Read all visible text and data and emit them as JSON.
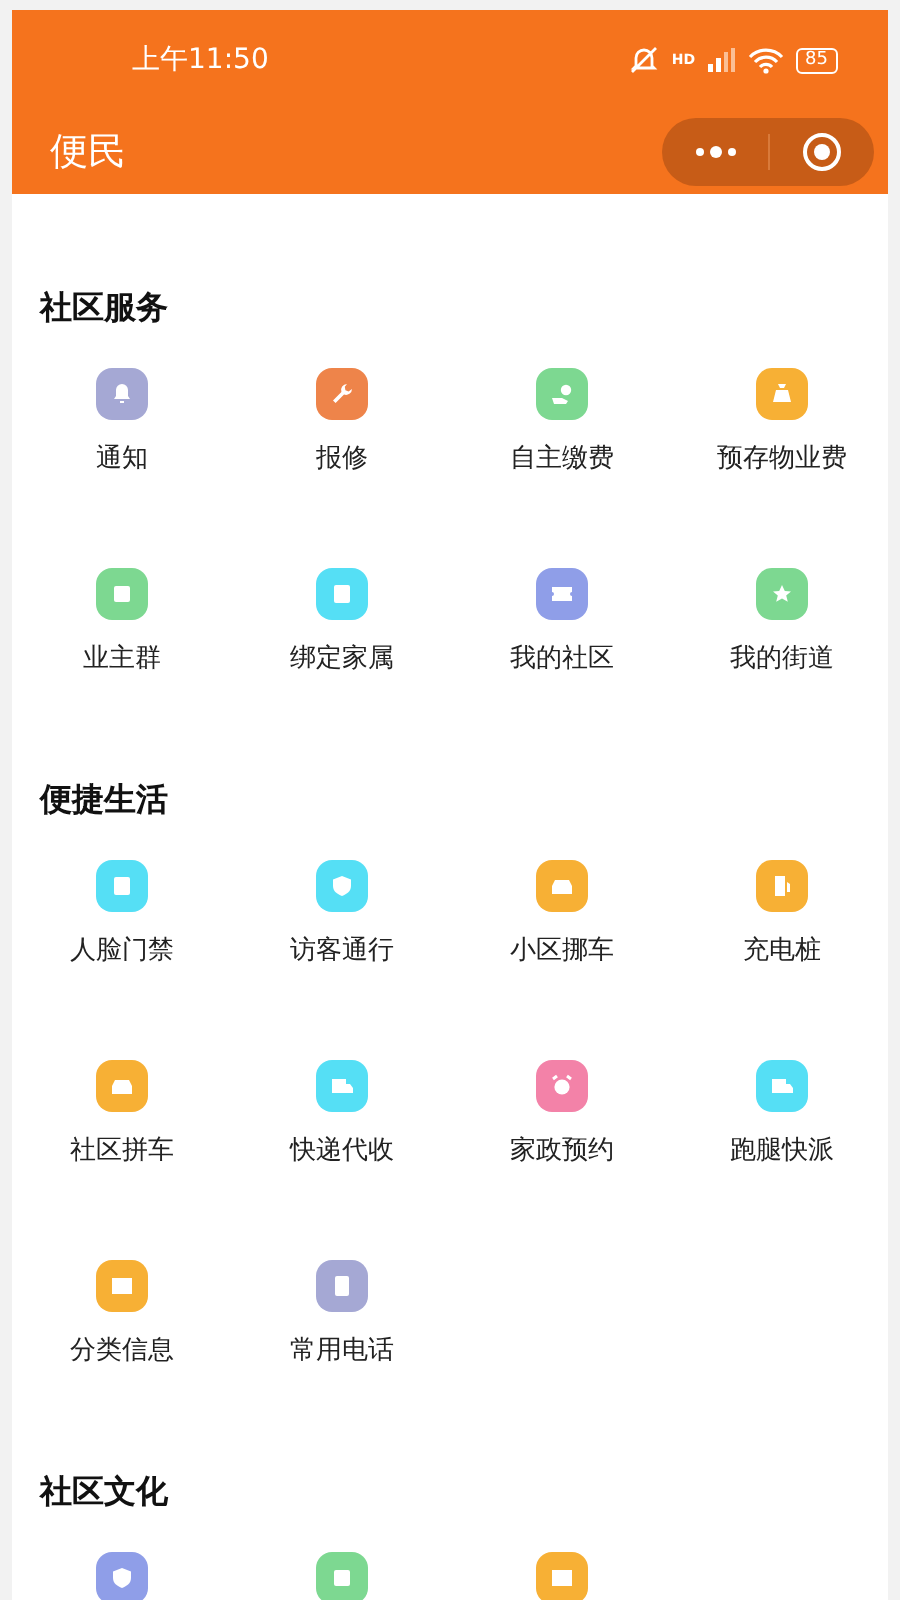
{
  "status_bar": {
    "time": "上午11:50",
    "network": "HD",
    "battery": "85"
  },
  "nav_bar": {
    "title": "便民"
  },
  "sections": [
    {
      "title": "社区服务",
      "items": [
        {
          "label": "通知",
          "kind": "bell",
          "color": "#a5a8d4"
        },
        {
          "label": "报修",
          "kind": "wrench",
          "color": "#ee844a"
        },
        {
          "label": "自主缴费",
          "kind": "coin",
          "color": "#7dd891"
        },
        {
          "label": "预存物业费",
          "kind": "bag",
          "color": "#f7b035"
        },
        {
          "label": "业主群",
          "kind": "face",
          "color": "#7dd891"
        },
        {
          "label": "绑定家属",
          "kind": "portrait",
          "color": "#55dff5"
        },
        {
          "label": "我的社区",
          "kind": "ticket",
          "color": "#8f9ee8"
        },
        {
          "label": "我的街道",
          "kind": "star",
          "color": "#7dd891"
        }
      ]
    },
    {
      "title": "便捷生活",
      "items": [
        {
          "label": "人脸门禁",
          "kind": "portrait",
          "color": "#55dff5"
        },
        {
          "label": "访客通行",
          "kind": "shield",
          "color": "#55dff5"
        },
        {
          "label": "小区挪车",
          "kind": "car",
          "color": "#f7b035"
        },
        {
          "label": "充电桩",
          "kind": "fuel",
          "color": "#f7b035"
        },
        {
          "label": "社区拼车",
          "kind": "car",
          "color": "#f7b035"
        },
        {
          "label": "快递代收",
          "kind": "truck",
          "color": "#55dff5"
        },
        {
          "label": "家政预约",
          "kind": "alarm",
          "color": "#f382a8"
        },
        {
          "label": "跑腿快派",
          "kind": "truck",
          "color": "#55dff5"
        },
        {
          "label": "分类信息",
          "kind": "book",
          "color": "#f7b035"
        },
        {
          "label": "常用电话",
          "kind": "phone",
          "color": "#a5a8d4"
        }
      ]
    },
    {
      "title": "社区文化",
      "items": [
        {
          "kind": "shield",
          "color": "#8f9ee8"
        },
        {
          "kind": "face",
          "color": "#7dd891"
        },
        {
          "kind": "book",
          "color": "#f7b035"
        }
      ]
    }
  ]
}
